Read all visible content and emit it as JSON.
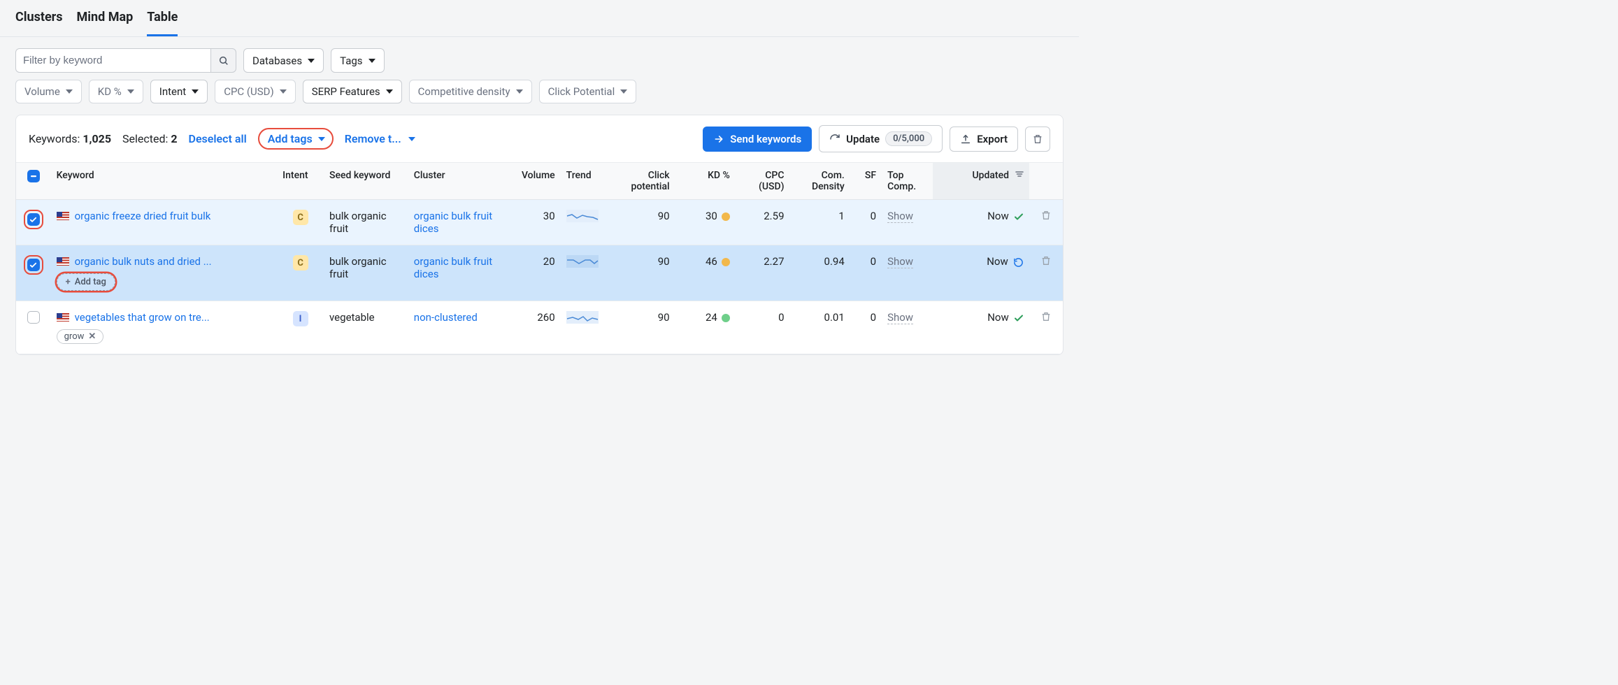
{
  "tabs": {
    "clusters": "Clusters",
    "mindmap": "Mind Map",
    "table": "Table"
  },
  "filters": {
    "search_placeholder": "Filter by keyword",
    "databases": "Databases",
    "tags": "Tags",
    "volume": "Volume",
    "kd": "KD %",
    "intent": "Intent",
    "cpc": "CPC (USD)",
    "serp": "SERP Features",
    "compdensity": "Competitive density",
    "clickpot": "Click Potential"
  },
  "panel": {
    "keywords_label": "Keywords:",
    "keywords_count": "1,025",
    "selected_label": "Selected:",
    "selected_count": "2",
    "deselect": "Deselect all",
    "add_tags": "Add tags",
    "remove": "Remove t...",
    "send": "Send keywords",
    "update": "Update",
    "update_badge": "0/5,000",
    "export": "Export"
  },
  "columns": {
    "keyword": "Keyword",
    "intent": "Intent",
    "seed": "Seed keyword",
    "cluster": "Cluster",
    "volume": "Volume",
    "trend": "Trend",
    "click": "Click potential",
    "kd": "KD %",
    "cpc": "CPC (USD)",
    "com": "Com. Density",
    "sf": "SF",
    "top": "Top Comp.",
    "updated": "Updated"
  },
  "rows": [
    {
      "checked": true,
      "keyword": "organic freeze dried fruit bulk",
      "intent": "C",
      "seed": "bulk organic fruit",
      "cluster": "organic bulk fruit dices",
      "volume": "30",
      "click": "90",
      "kd": "30",
      "kd_color": "orange",
      "cpc": "2.59",
      "com": "1",
      "sf": "0",
      "top": "Show",
      "updated": "Now",
      "updated_icon": "check"
    },
    {
      "checked": true,
      "keyword": "organic bulk nuts and dried ...",
      "intent": "C",
      "seed": "bulk organic fruit",
      "cluster": "organic bulk fruit dices",
      "volume": "20",
      "click": "90",
      "kd": "46",
      "kd_color": "orange",
      "cpc": "2.27",
      "com": "0.94",
      "sf": "0",
      "top": "Show",
      "updated": "Now",
      "updated_icon": "refresh",
      "add_tag_label": "Add tag"
    },
    {
      "checked": false,
      "keyword": "vegetables that grow on tre...",
      "intent": "I",
      "seed": "vegetable",
      "cluster": "non-clustered",
      "volume": "260",
      "click": "90",
      "kd": "24",
      "kd_color": "green",
      "cpc": "0",
      "com": "0.01",
      "sf": "0",
      "top": "Show",
      "updated": "Now",
      "updated_icon": "check",
      "tag": "grow"
    }
  ]
}
